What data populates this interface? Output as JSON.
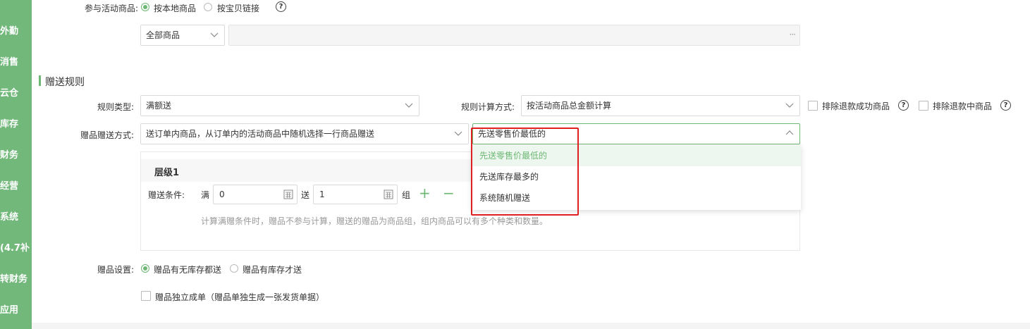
{
  "sidebar": {
    "items": [
      {
        "label": "外勤"
      },
      {
        "label": "消售"
      },
      {
        "label": "云仓"
      },
      {
        "label": "库存"
      },
      {
        "label": "财务"
      },
      {
        "label": "经营"
      },
      {
        "label": "系统"
      },
      {
        "label": "(4.7补"
      },
      {
        "label": "转财务"
      },
      {
        "label": "应用"
      }
    ]
  },
  "participating_goods": {
    "label": "参与活动商品:",
    "option_local": "按本地商品",
    "option_link": "按宝贝链接",
    "help": "?",
    "scope_select": "全部商品",
    "picker_more": "···"
  },
  "section": {
    "title": "赠送规则"
  },
  "rule_type": {
    "label": "规则类型:",
    "value": "满额送"
  },
  "calc_method": {
    "label": "规则计算方式:",
    "value": "按活动商品总金额计算"
  },
  "exclude_refunded": {
    "label": "排除退款成功商品",
    "help": "?"
  },
  "exclude_refunding": {
    "label": "排除退款中商品",
    "help": "?"
  },
  "gift_method": {
    "label": "赠品赠送方式:",
    "value": "送订单内商品，从订单内的活动商品中随机选择一行商品赠送",
    "priority_value": "先送零售价最低的",
    "options": [
      "先送零售价最低的",
      "先送库存最多的",
      "系统随机赠送"
    ]
  },
  "tier": {
    "title": "层级1",
    "condition_label": "赠送条件:",
    "full_label": "满",
    "full_value": "0",
    "give_label": "送",
    "give_value": "1",
    "unit": "组",
    "add_symbol": "+",
    "remove_symbol": "−",
    "hint": "计算满赠条件时，赠品不参与计算，赠送的赠品为商品组，组内商品可以有多个种类和数量。"
  },
  "gift_settings": {
    "label": "赠品设置:",
    "option_any": "赠品有无库存都送",
    "option_instock": "赠品有库存才送",
    "standalone": "赠品独立成单（赠品单独生成一张发货单据）"
  },
  "colors": {
    "accent": "#6db874",
    "sidebar": "#71b87a",
    "highlight": "#e02020"
  }
}
